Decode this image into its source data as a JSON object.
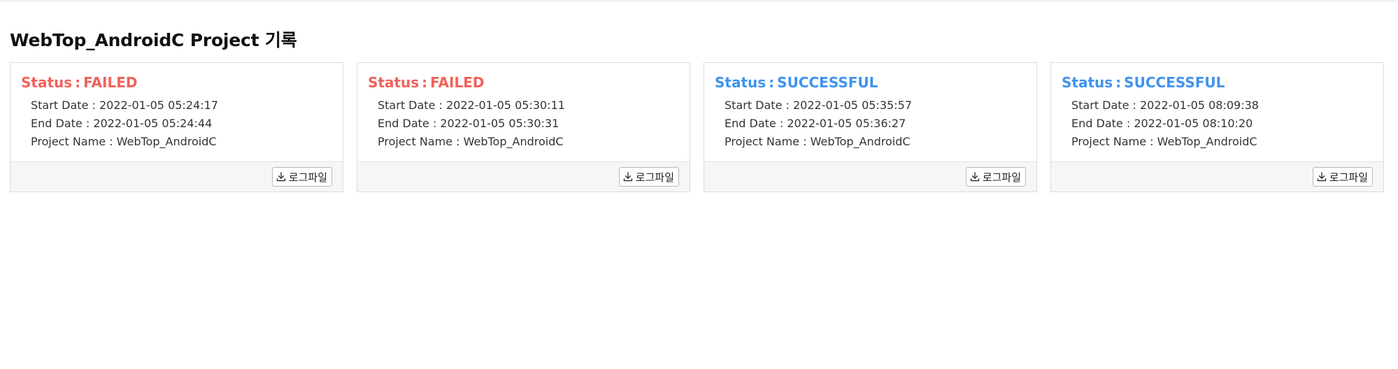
{
  "page": {
    "title": "WebTop_AndroidC Project 기록"
  },
  "colors": {
    "failed": "#f1625c",
    "successful": "#3f93ee"
  },
  "labels": {
    "status": "Status",
    "separator": ":",
    "start_date": "Start Date",
    "end_date": "End Date",
    "project_name": "Project Name",
    "log_button": "로그파일"
  },
  "cards": [
    {
      "status": "FAILED",
      "start_date": "2022-01-05 05:24:17",
      "end_date": "2022-01-05 05:24:44",
      "project_name": "WebTop_AndroidC"
    },
    {
      "status": "FAILED",
      "start_date": "2022-01-05 05:30:11",
      "end_date": "2022-01-05 05:30:31",
      "project_name": "WebTop_AndroidC"
    },
    {
      "status": "SUCCESSFUL",
      "start_date": "2022-01-05 05:35:57",
      "end_date": "2022-01-05 05:36:27",
      "project_name": "WebTop_AndroidC"
    },
    {
      "status": "SUCCESSFUL",
      "start_date": "2022-01-05 08:09:38",
      "end_date": "2022-01-05 08:10:20",
      "project_name": "WebTop_AndroidC"
    }
  ]
}
